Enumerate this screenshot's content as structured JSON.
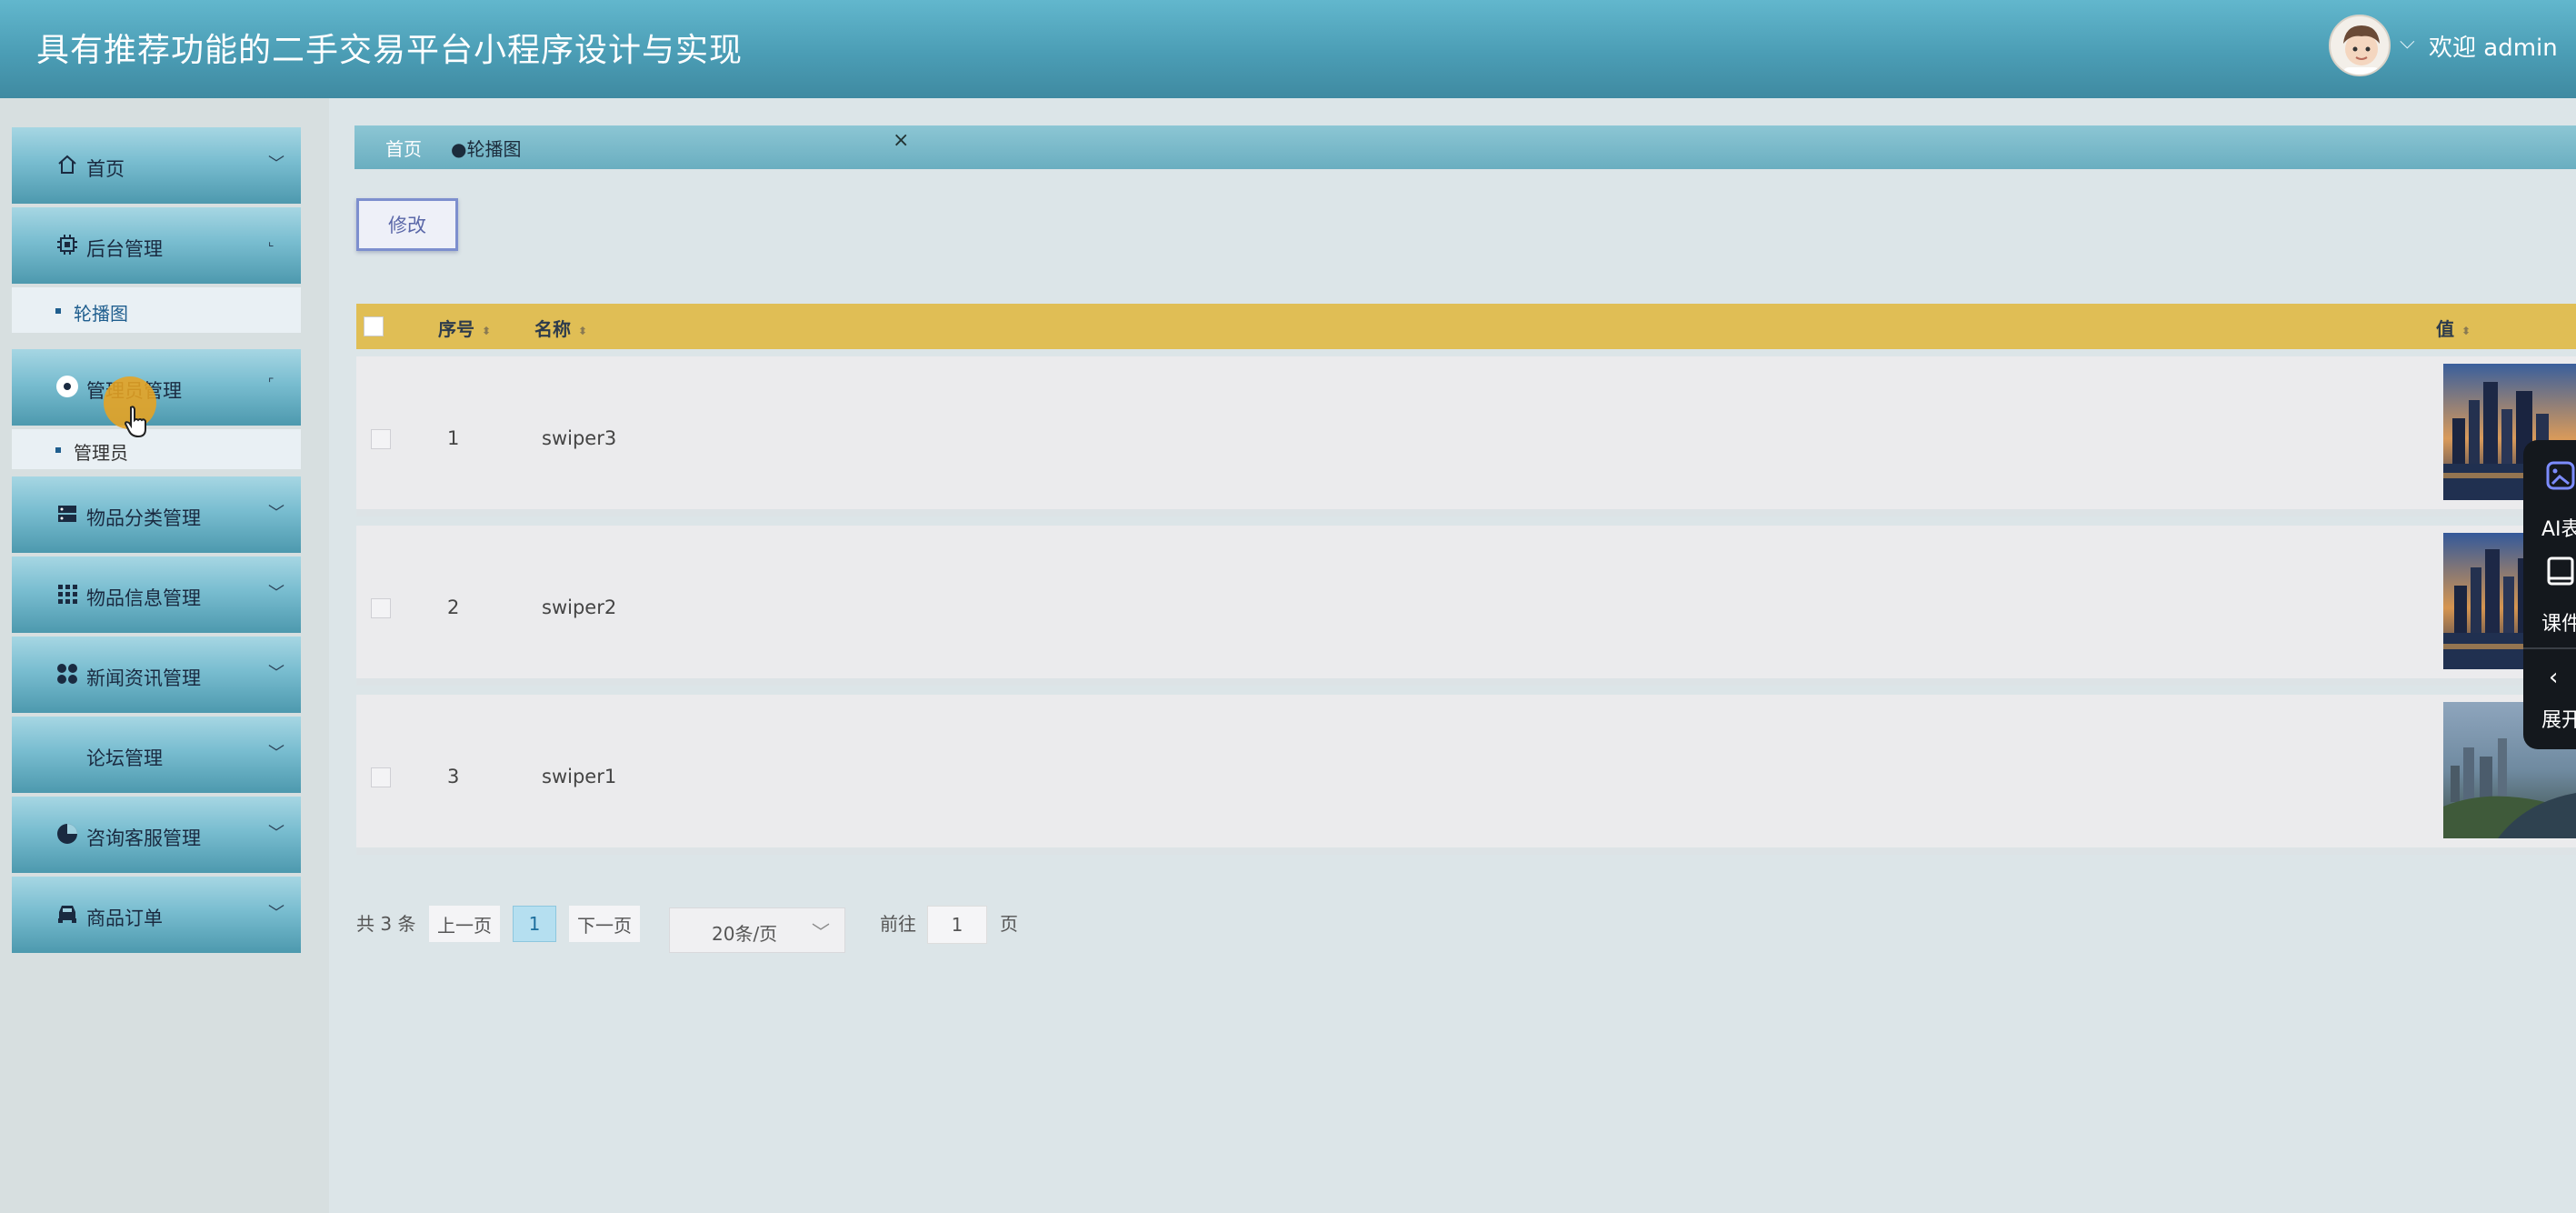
{
  "header": {
    "title": "具有推荐功能的二手交易平台小程序设计与实现",
    "welcome": "欢迎 admin",
    "caret": "⌵"
  },
  "sidebar": {
    "menus": [
      {
        "label": "首页",
        "icon": "home-icon"
      },
      {
        "label": "后台管理",
        "icon": "chip-icon"
      },
      {
        "label": "管理员管理",
        "icon": "user-circle-icon"
      },
      {
        "label": "物品分类管理",
        "icon": "server-icon"
      },
      {
        "label": "物品信息管理",
        "icon": "grid-icon"
      },
      {
        "label": "新闻资讯管理",
        "icon": "apps-icon"
      },
      {
        "label": "论坛管理",
        "icon": ""
      },
      {
        "label": "咨询客服管理",
        "icon": "pie-icon"
      },
      {
        "label": "商品订单",
        "icon": "car-icon"
      }
    ],
    "subitems": {
      "carousel": "轮播图",
      "admin": "管理员"
    }
  },
  "breadcrumb": {
    "home": "首页",
    "current": "●轮播图",
    "close": "×"
  },
  "toolbar": {
    "edit_label": "修改"
  },
  "table": {
    "columns": {
      "index": "序号",
      "name": "名称",
      "value": "值"
    },
    "rows": [
      {
        "index": "1",
        "name": "swiper3"
      },
      {
        "index": "2",
        "name": "swiper2"
      },
      {
        "index": "3",
        "name": "swiper1"
      }
    ]
  },
  "pagination": {
    "total": "共 3 条",
    "prev": "上一页",
    "current": "1",
    "next": "下一页",
    "page_size": "20条/页",
    "goto_label": "前往",
    "goto_value": "1",
    "page_suffix": "页"
  },
  "float_panel": {
    "ai_label": "AI表",
    "course_label": "课件",
    "expand_label": "展开"
  },
  "colors": {
    "header": "#4b9db5",
    "table_header": "#e0be55",
    "accent": "#1f5e8e"
  }
}
